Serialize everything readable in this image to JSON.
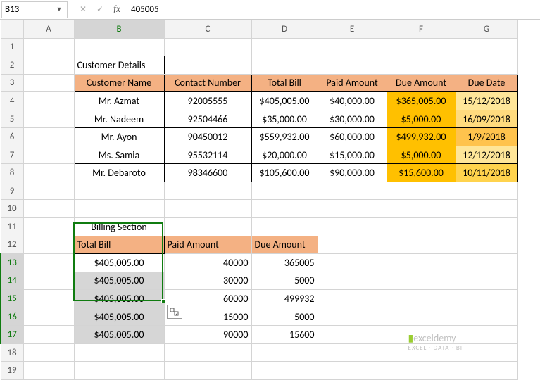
{
  "nameBox": "B13",
  "formulaBar": "405005",
  "columns": [
    "A",
    "B",
    "C",
    "D",
    "E",
    "F",
    "G"
  ],
  "rowCount": 19,
  "selectedRows": [
    13,
    14,
    15,
    16,
    17
  ],
  "selectedCol": "B",
  "table1": {
    "title": "Customer Details",
    "headers": [
      "Customer Name",
      "Contact Number",
      "Total Bill",
      "Paid Amount",
      "Due Amount",
      "Due Date"
    ],
    "rows": [
      {
        "name": "Mr. Azmat",
        "contact": "92005555",
        "total": "$405,005.00",
        "paid": "$40,000.00",
        "due": "$365,005.00",
        "date": "15/12/2018"
      },
      {
        "name": "Mr. Nadeem",
        "contact": "92504466",
        "total": "$35,000.00",
        "paid": "$30,000.00",
        "due": "$5,000.00",
        "date": "16/09/2018"
      },
      {
        "name": "Mr. Ayon",
        "contact": "90450012",
        "total": "$559,932.00",
        "paid": "$60,000.00",
        "due": "$499,932.00",
        "date": "1/9/2018"
      },
      {
        "name": "Ms. Samia",
        "contact": "95532114",
        "total": "$20,000.00",
        "paid": "$15,000.00",
        "due": "$5,000.00",
        "date": "12/12/2018"
      },
      {
        "name": "Mr. Debaroto",
        "contact": "98346600",
        "total": "$105,600.00",
        "paid": "$90,000.00",
        "due": "$15,600.00",
        "date": "10/11/2018"
      }
    ]
  },
  "table2": {
    "title": "Billing Section",
    "headers": [
      "Total Bill",
      "Paid Amount",
      "Due Amount"
    ],
    "rows": [
      {
        "total": "$405,005.00",
        "paid": "40000",
        "due": "365005"
      },
      {
        "total": "$405,005.00",
        "paid": "30000",
        "due": "5000"
      },
      {
        "total": "$405,005.00",
        "paid": "60000",
        "due": "499932"
      },
      {
        "total": "$405,005.00",
        "paid": "15000",
        "due": "5000"
      },
      {
        "total": "$405,005.00",
        "paid": "90000",
        "due": "15600"
      }
    ]
  },
  "watermark": {
    "brand": "exceldemy",
    "tagline": "EXCEL · DATA · BI"
  },
  "chart_data": {
    "type": "table",
    "title": "Customer Details",
    "columns": [
      "Customer Name",
      "Contact Number",
      "Total Bill",
      "Paid Amount",
      "Due Amount",
      "Due Date"
    ],
    "rows": [
      [
        "Mr. Azmat",
        92005555,
        405005,
        40000,
        365005,
        "15/12/2018"
      ],
      [
        "Mr. Nadeem",
        92504466,
        35000,
        30000,
        5000,
        "16/09/2018"
      ],
      [
        "Mr. Ayon",
        90450012,
        559932,
        60000,
        499932,
        "1/9/2018"
      ],
      [
        "Ms. Samia",
        95532114,
        20000,
        15000,
        5000,
        "12/12/2018"
      ],
      [
        "Mr. Debaroto",
        98346600,
        105600,
        90000,
        15600,
        "10/11/2018"
      ]
    ]
  }
}
